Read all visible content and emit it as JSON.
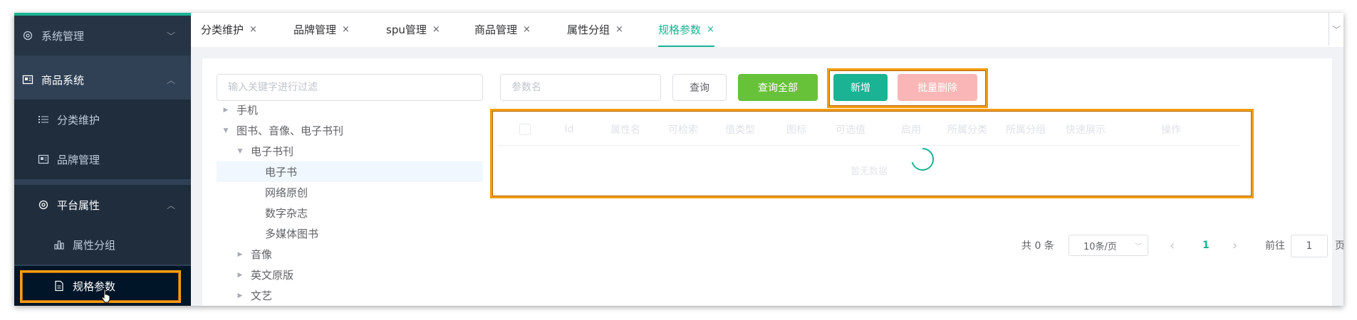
{
  "sidebar": {
    "items": [
      {
        "label": "系统管理",
        "icon": "gear-icon",
        "chevron": "﹀"
      },
      {
        "label": "商品系统",
        "icon": "id-card-icon",
        "chevron": "︿"
      },
      {
        "label": "分类维护",
        "icon": "list-icon"
      },
      {
        "label": "品牌管理",
        "icon": "id-card-icon"
      },
      {
        "label": "平台属性",
        "icon": "gear-icon",
        "chevron": "︿"
      },
      {
        "label": "属性分组",
        "icon": "bar-chart-icon"
      },
      {
        "label": "规格参数",
        "icon": "document-icon"
      }
    ]
  },
  "tabs": [
    {
      "label": "分类维护",
      "close": "×"
    },
    {
      "label": "品牌管理",
      "close": "×"
    },
    {
      "label": "spu管理",
      "close": "×"
    },
    {
      "label": "商品管理",
      "close": "×"
    },
    {
      "label": "属性分组",
      "close": "×"
    },
    {
      "label": "规格参数",
      "close": "×"
    }
  ],
  "tabs_more": "﹀",
  "filter": {
    "placeholder": "输入关键字进行过滤"
  },
  "tree": [
    {
      "label": "手机",
      "arrow": "▶"
    },
    {
      "label": "图书、音像、电子书刊",
      "arrow": "▼"
    },
    {
      "label": "电子书刊",
      "arrow": "▼"
    },
    {
      "label": "电子书",
      "arrow": ""
    },
    {
      "label": "网络原创",
      "arrow": ""
    },
    {
      "label": "数字杂志",
      "arrow": ""
    },
    {
      "label": "多媒体图书",
      "arrow": ""
    },
    {
      "label": "音像",
      "arrow": "▶"
    },
    {
      "label": "英文原版",
      "arrow": "▶"
    },
    {
      "label": "文艺",
      "arrow": "▶"
    }
  ],
  "search": {
    "placeholder": "参数名",
    "query_label": "查询",
    "query_all_label": "查询全部",
    "add_label": "新增",
    "batch_delete_label": "批量删除"
  },
  "table": {
    "columns": [
      "Id",
      "属性名",
      "可检索",
      "值类型",
      "图标",
      "可选值",
      "启用",
      "所属分类",
      "所属分组",
      "快速展示",
      "操作"
    ],
    "empty_text": "暂无数据"
  },
  "pagination": {
    "total": "共 0 条",
    "page_size": "10条/页",
    "prev": "‹",
    "current": "1",
    "next": "›",
    "goto_label": "前往",
    "goto_value": "1",
    "page_suffix": "页"
  },
  "colors": {
    "sidebar_bg": "#304156",
    "accent": "#1ab394",
    "highlight": "#f39c12",
    "success": "#67c23a",
    "danger_disabled": "#fab6b6"
  }
}
